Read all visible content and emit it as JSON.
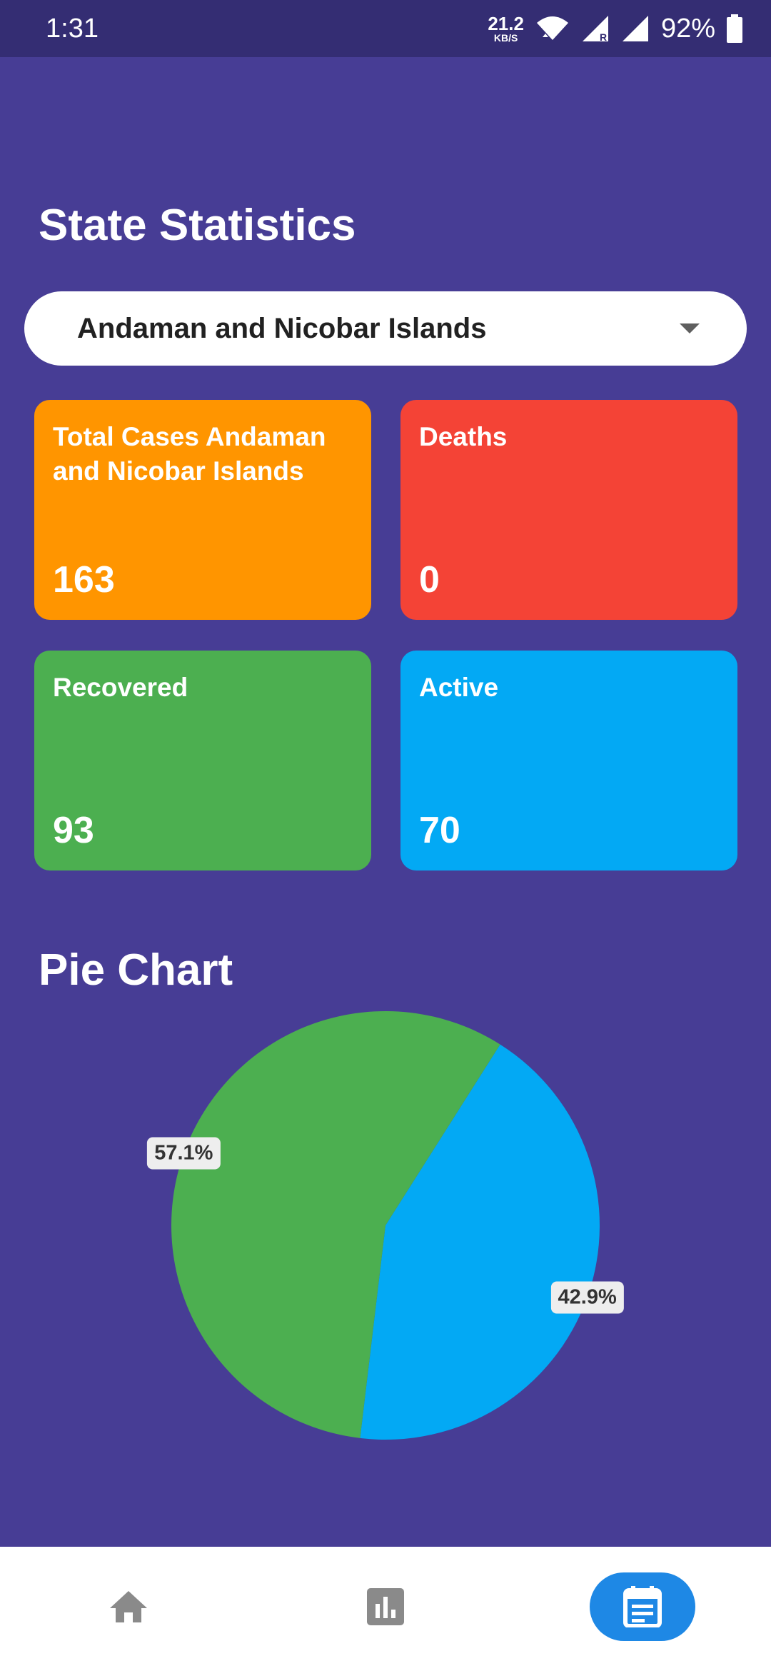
{
  "status_bar": {
    "time": "1:31",
    "net_speed_value": "21.2",
    "net_speed_unit": "KB/S",
    "battery": "92%",
    "icons": [
      "wifi-icon",
      "signal-roaming-icon",
      "signal-icon",
      "battery-icon"
    ]
  },
  "page": {
    "title": "State Statistics",
    "background_color": "#473d95"
  },
  "state_select": {
    "selected": "Andaman and Nicobar Islands"
  },
  "cards": {
    "total": {
      "label": "Total Cases Andaman and Nicobar Islands",
      "value": "163",
      "color": "#ff9500"
    },
    "deaths": {
      "label": "Deaths",
      "value": "0",
      "color": "#f44336"
    },
    "recovered": {
      "label": "Recovered",
      "value": "93",
      "color": "#4caf50"
    },
    "active": {
      "label": "Active",
      "value": "70",
      "color": "#03a9f4"
    }
  },
  "pie": {
    "title": "Pie Chart"
  },
  "chart_data": {
    "type": "pie",
    "slices": [
      {
        "value": 42.9,
        "label": "42.9%",
        "color": "#03a9f4"
      },
      {
        "value": 57.1,
        "label": "57.1%",
        "color": "#4caf50"
      }
    ]
  },
  "bottom_nav": {
    "items": [
      {
        "icon": "home-icon",
        "active": false
      },
      {
        "icon": "bar-chart-icon",
        "active": false
      },
      {
        "icon": "event-note-icon",
        "active": true
      }
    ],
    "active_color": "#1e88e5"
  }
}
